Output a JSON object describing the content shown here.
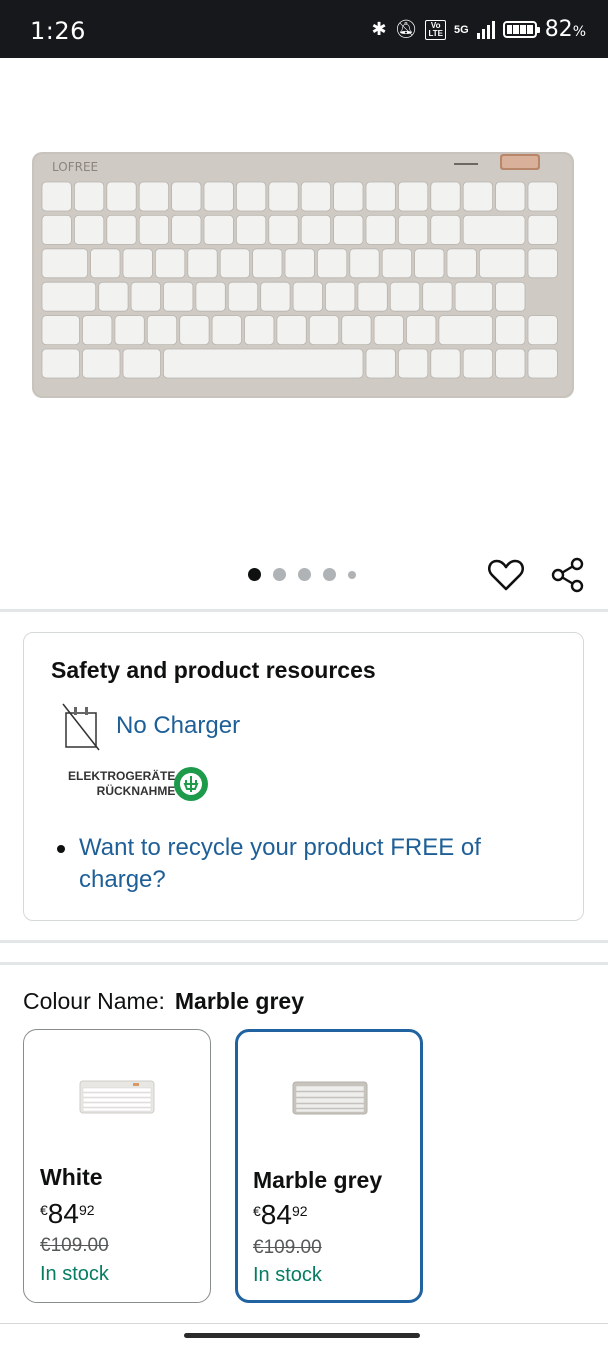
{
  "status_bar": {
    "time": "1:26",
    "network": "5G",
    "volte": "VoLTE",
    "battery_percent": "82",
    "battery_unit": "%"
  },
  "product_image": {
    "brand_label": "LOFREE",
    "alt_icon": "keyboard-image"
  },
  "carousel": {
    "total_dots": 5,
    "active_index": 0
  },
  "actions": {
    "wishlist_icon": "heart-icon",
    "share_icon": "share-icon"
  },
  "safety_card": {
    "title": "Safety and product resources",
    "charger_label": "No Charger",
    "weee_line1": "ELEKTROGERÄTE",
    "weee_line2": "RÜCKNAHME",
    "recycle_link": "Want to recycle your product FREE of charge?"
  },
  "colour": {
    "label": "Colour Name:",
    "selected": "Marble grey",
    "options": [
      {
        "name": "White",
        "currency": "€",
        "price_whole": "84",
        "price_fraction": "92",
        "old_price": "€109.00",
        "stock": "In stock",
        "selected": false
      },
      {
        "name": "Marble grey",
        "currency": "€",
        "price_whole": "84",
        "price_fraction": "92",
        "old_price": "€109.00",
        "stock": "In stock",
        "selected": true
      }
    ]
  },
  "colors": {
    "link": "#1f5f97",
    "selected_border": "#2162a1",
    "stock_green": "#067d62"
  }
}
